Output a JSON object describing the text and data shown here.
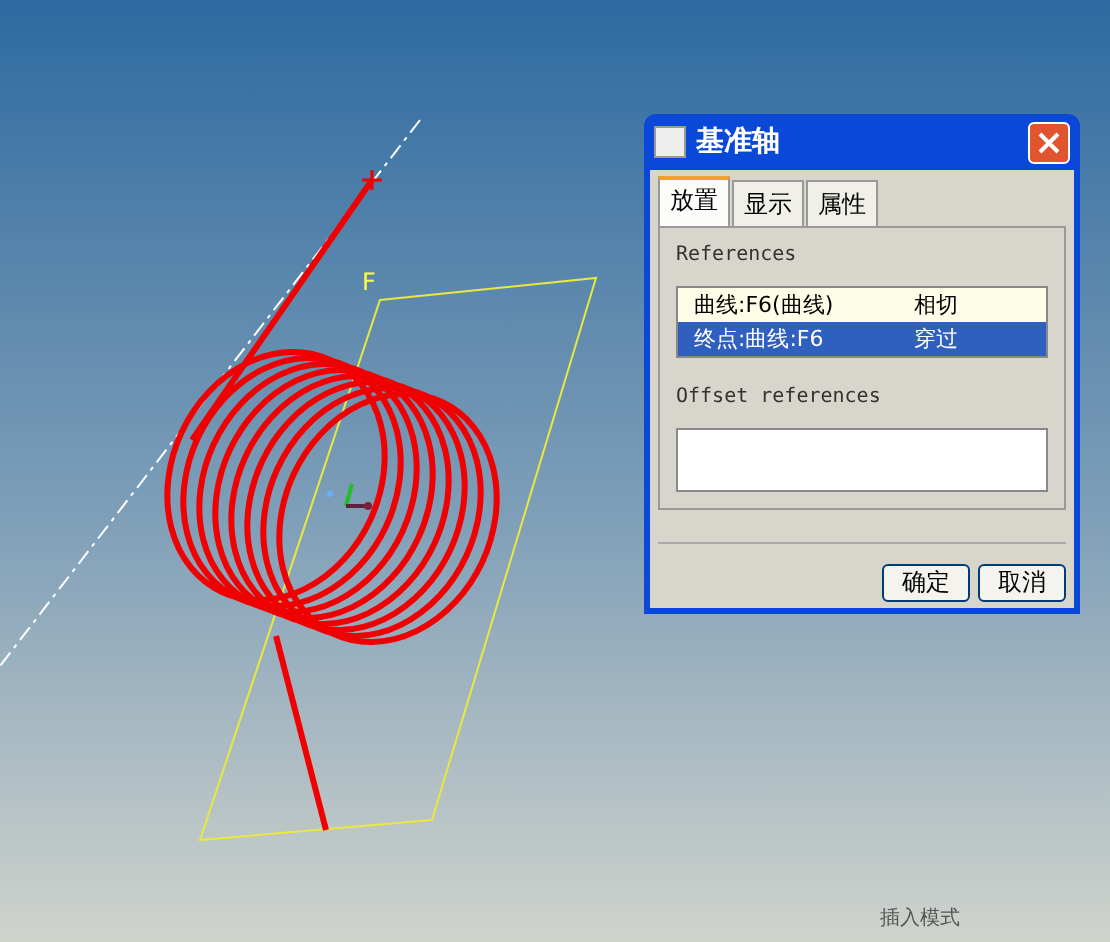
{
  "viewport": {
    "plane_label": "F",
    "status": "插入模式"
  },
  "dialog": {
    "title": "基准轴",
    "tabs": [
      {
        "label": "放置",
        "selected": true
      },
      {
        "label": "显示",
        "selected": false
      },
      {
        "label": "属性",
        "selected": false
      }
    ],
    "references_label": "References",
    "references": [
      {
        "reference": "曲线:F6(曲线)",
        "constraint": "相切",
        "selected": false
      },
      {
        "reference": "终点:曲线:F6",
        "constraint": "穿过",
        "selected": true
      }
    ],
    "offset_label": "Offset references",
    "buttons": [
      "确定",
      "取消"
    ]
  }
}
